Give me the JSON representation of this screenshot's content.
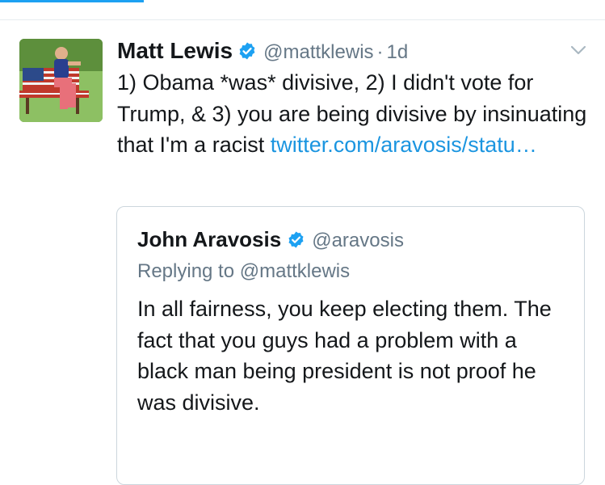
{
  "colors": {
    "accent": "#1da1f2",
    "link": "#1b95e0",
    "secondary_text": "#657786",
    "border": "#ccd6dd"
  },
  "tweet": {
    "author_name": "Matt Lewis",
    "author_handle": "@mattklewis",
    "separator": "·",
    "time": "1d",
    "verified_icon": "verified-badge-icon",
    "menu_icon": "chevron-down-icon",
    "text": "1) Obama *was* divisive, 2) I didn't vote for Trump, & 3) you are being divisive by insinuating that I'm a racist ",
    "link_text": "twitter.com/aravosis/statu…"
  },
  "quoted_tweet": {
    "author_name": "John Aravosis",
    "author_handle": "@aravosis",
    "verified_icon": "verified-badge-icon",
    "replying_to": "Replying to @mattklewis",
    "text": "In all fairness, you keep electing them. The fact that you guys had a problem with a black man being president is not proof he was divisive."
  }
}
